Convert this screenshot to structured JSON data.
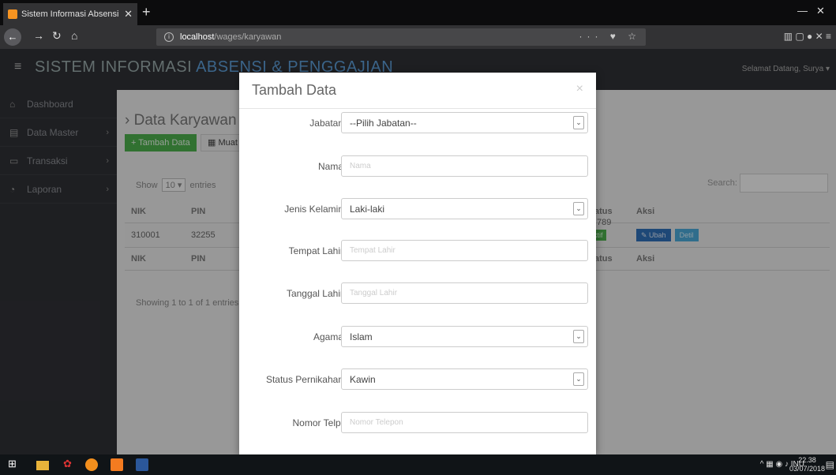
{
  "browser": {
    "tab_title": "Sistem Informasi Absensi & Pe",
    "url_host": "localhost",
    "url_path": "/wages/karyawan"
  },
  "app": {
    "brand_main": "SISTEM INFORMASI",
    "brand_accent": "ABSENSI & PENGGAJIAN",
    "welcome": "Selamat Datang, Surya"
  },
  "sidebar": {
    "items": [
      {
        "label": "Dashboard",
        "icon": "home-icon"
      },
      {
        "label": "Data Master",
        "icon": "document-icon"
      },
      {
        "label": "Transaksi",
        "icon": "monitor-icon"
      },
      {
        "label": "Laporan",
        "icon": "pie-chart-icon"
      }
    ]
  },
  "content": {
    "title": "Data Karyawan",
    "add_button": "+ Tambah Data",
    "load_button": "Muat Ulang",
    "show_label": "Show",
    "show_value": "10",
    "entries_label": "entries",
    "search_label": "Search:",
    "table": {
      "columns": [
        "NIK",
        "PIN",
        "",
        "",
        "",
        "",
        "Status",
        "Aksi"
      ],
      "rows": [
        {
          "nik": "310001",
          "pin": "32255",
          "phone_suffix": "789",
          "status": "Aktif",
          "edit": "Ubah",
          "detail": "Detil"
        }
      ]
    },
    "info": "Showing 1 to 1 of 1 entries"
  },
  "modal": {
    "title": "Tambah Data",
    "close": "×",
    "fields": [
      {
        "label": "Jabatan",
        "type": "select",
        "value": "--Pilih Jabatan--"
      },
      {
        "label": "Nama",
        "type": "input",
        "placeholder": "Nama"
      },
      {
        "label": "Jenis Kelamin",
        "type": "select",
        "value": "Laki-laki"
      },
      {
        "label": "Tempat Lahir",
        "type": "input",
        "placeholder": "Tempat Lahir"
      },
      {
        "label": "Tanggal Lahir",
        "type": "input",
        "placeholder": "Tanggal Lahir"
      },
      {
        "label": "Agama",
        "type": "select",
        "value": "Islam"
      },
      {
        "label": "Status Pernikahan",
        "type": "select",
        "value": "Kawin"
      },
      {
        "label": "Nomor Telp.",
        "type": "input",
        "placeholder": "Nomor Telepon"
      }
    ]
  },
  "taskbar": {
    "lang": "INU",
    "time": "22.38",
    "date": "03/07/2018"
  }
}
